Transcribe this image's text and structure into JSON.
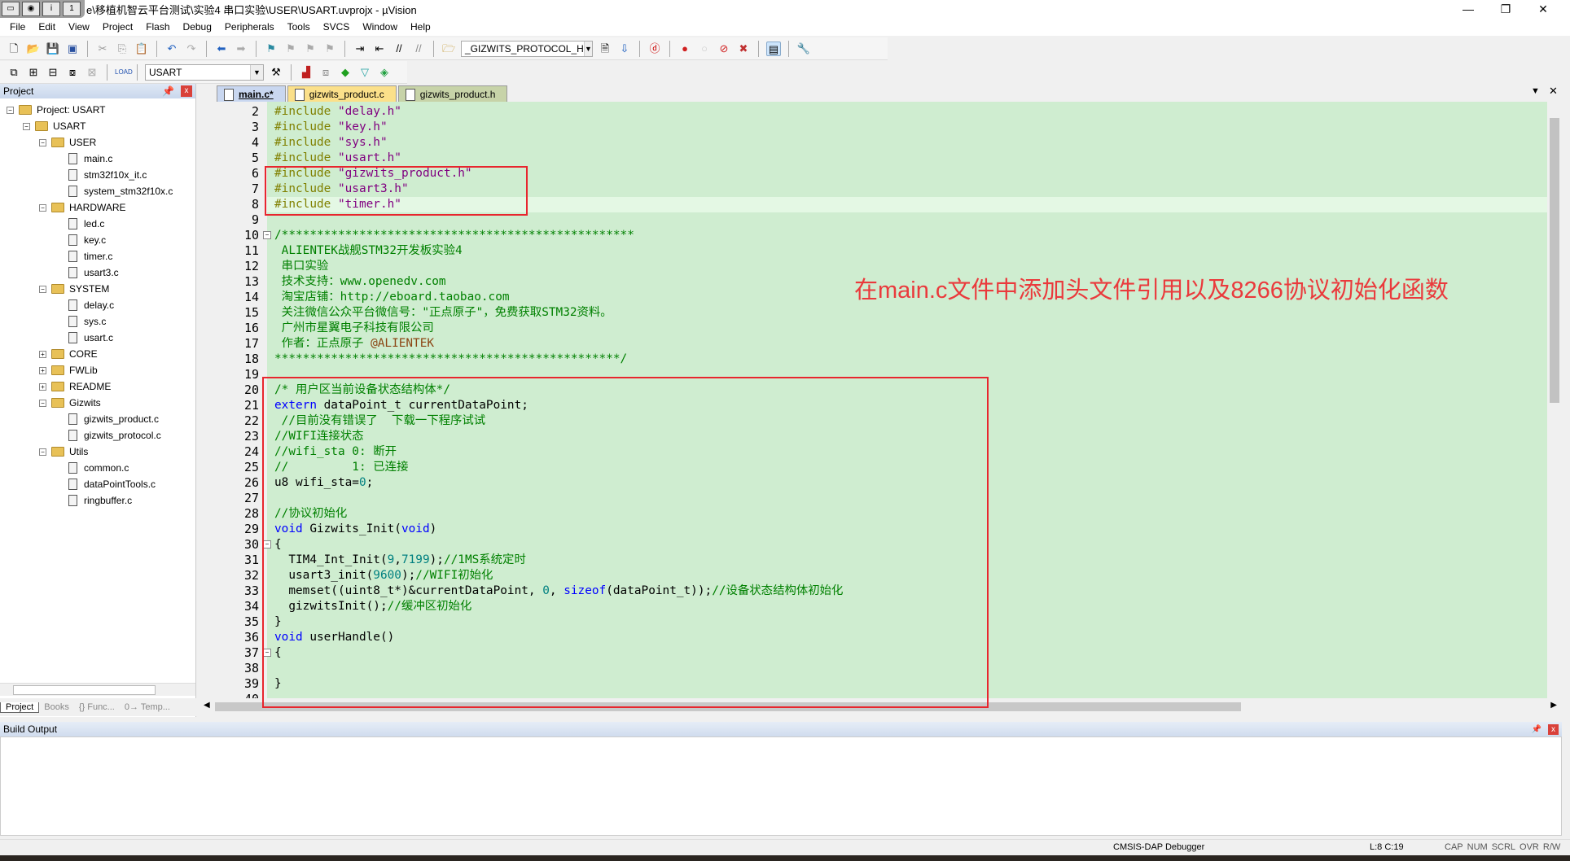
{
  "window": {
    "title": "e\\移植机智云平台测试\\实验4 串口实验\\USER\\USART.uvprojx - µVision",
    "minimize": "—",
    "restore": "❐",
    "close": "✕"
  },
  "menu": [
    "File",
    "Edit",
    "View",
    "Project",
    "Flash",
    "Debug",
    "Peripherals",
    "Tools",
    "SVCS",
    "Window",
    "Help"
  ],
  "toolbar": {
    "find_combo": "_GIZWITS_PROTOCOL_H",
    "target_combo": "USART"
  },
  "project_panel": {
    "title": "Project",
    "tree": [
      {
        "label": "Project: USART",
        "level": 0,
        "type": "root",
        "toggle": "−"
      },
      {
        "label": "USART",
        "level": 1,
        "type": "folder",
        "toggle": "−"
      },
      {
        "label": "USER",
        "level": 2,
        "type": "folder",
        "toggle": "−"
      },
      {
        "label": "main.c",
        "level": 3,
        "type": "file"
      },
      {
        "label": "stm32f10x_it.c",
        "level": 3,
        "type": "file"
      },
      {
        "label": "system_stm32f10x.c",
        "level": 3,
        "type": "file"
      },
      {
        "label": "HARDWARE",
        "level": 2,
        "type": "folder",
        "toggle": "−"
      },
      {
        "label": "led.c",
        "level": 3,
        "type": "file"
      },
      {
        "label": "key.c",
        "level": 3,
        "type": "file"
      },
      {
        "label": "timer.c",
        "level": 3,
        "type": "file"
      },
      {
        "label": "usart3.c",
        "level": 3,
        "type": "file"
      },
      {
        "label": "SYSTEM",
        "level": 2,
        "type": "folder",
        "toggle": "−"
      },
      {
        "label": "delay.c",
        "level": 3,
        "type": "file"
      },
      {
        "label": "sys.c",
        "level": 3,
        "type": "file"
      },
      {
        "label": "usart.c",
        "level": 3,
        "type": "file"
      },
      {
        "label": "CORE",
        "level": 2,
        "type": "folder",
        "toggle": "+"
      },
      {
        "label": "FWLib",
        "level": 2,
        "type": "folder",
        "toggle": "+"
      },
      {
        "label": "README",
        "level": 2,
        "type": "folder",
        "toggle": "+"
      },
      {
        "label": "Gizwits",
        "level": 2,
        "type": "folder",
        "toggle": "−"
      },
      {
        "label": "gizwits_product.c",
        "level": 3,
        "type": "file"
      },
      {
        "label": "gizwits_protocol.c",
        "level": 3,
        "type": "file"
      },
      {
        "label": "Utils",
        "level": 2,
        "type": "folder",
        "toggle": "−"
      },
      {
        "label": "common.c",
        "level": 3,
        "type": "file"
      },
      {
        "label": "dataPointTools.c",
        "level": 3,
        "type": "file"
      },
      {
        "label": "ringbuffer.c",
        "level": 3,
        "type": "file"
      }
    ],
    "bottom_tabs": [
      "Project",
      "Books",
      "{} Func...",
      "0→ Temp..."
    ]
  },
  "editor_tabs": [
    {
      "label": "main.c*",
      "active": true,
      "color": "#c9d7f0"
    },
    {
      "label": "gizwits_product.c",
      "active": false,
      "color": "#fbe08a"
    },
    {
      "label": "gizwits_product.h",
      "active": false,
      "color": "#c7d3a8"
    }
  ],
  "code": {
    "current_line": 8,
    "lines": [
      {
        "n": 2,
        "s": [
          [
            "#include ",
            "pp"
          ],
          [
            "\"delay.h\"",
            "str"
          ]
        ]
      },
      {
        "n": 3,
        "s": [
          [
            "#include ",
            "pp"
          ],
          [
            "\"key.h\"",
            "str"
          ]
        ]
      },
      {
        "n": 4,
        "s": [
          [
            "#include ",
            "pp"
          ],
          [
            "\"sys.h\"",
            "str"
          ]
        ]
      },
      {
        "n": 5,
        "s": [
          [
            "#include ",
            "pp"
          ],
          [
            "\"usart.h\"",
            "str"
          ]
        ]
      },
      {
        "n": 6,
        "s": [
          [
            "#include ",
            "pp"
          ],
          [
            "\"gizwits_product.h\"",
            "str"
          ]
        ]
      },
      {
        "n": 7,
        "s": [
          [
            "#include ",
            "pp"
          ],
          [
            "\"usart3.h\"",
            "str"
          ]
        ]
      },
      {
        "n": 8,
        "s": [
          [
            "#include ",
            "pp"
          ],
          [
            "\"timer.h\"",
            "str"
          ]
        ]
      },
      {
        "n": 9,
        "s": []
      },
      {
        "n": 10,
        "fold": true,
        "s": [
          [
            "/**************************************************",
            "cm"
          ]
        ]
      },
      {
        "n": 11,
        "s": [
          [
            " ALIENTEK战舰STM32开发板实验4",
            "cm"
          ]
        ]
      },
      {
        "n": 12,
        "s": [
          [
            " 串口实验",
            "cm"
          ]
        ]
      },
      {
        "n": 13,
        "s": [
          [
            " 技术支持：www.openedv.com",
            "cm"
          ]
        ]
      },
      {
        "n": 14,
        "s": [
          [
            " 淘宝店铺：http://eboard.taobao.com",
            "cm"
          ]
        ]
      },
      {
        "n": 15,
        "s": [
          [
            " 关注微信公众平台微信号：\"正点原子\"，免费获取STM32资料。",
            "cm"
          ]
        ]
      },
      {
        "n": 16,
        "s": [
          [
            " 广州市星翼电子科技有限公司",
            "cm"
          ]
        ]
      },
      {
        "n": 17,
        "s": [
          [
            " 作者：正点原子 ",
            "cm"
          ],
          [
            "@ALIENTEK",
            "cmb"
          ]
        ]
      },
      {
        "n": 18,
        "s": [
          [
            "*************************************************/",
            "cm"
          ]
        ]
      },
      {
        "n": 19,
        "s": []
      },
      {
        "n": 20,
        "s": [
          [
            "/* 用户区当前设备状态结构体*/",
            "cm"
          ]
        ]
      },
      {
        "n": 21,
        "s": [
          [
            "extern",
            "kw"
          ],
          [
            " dataPoint_t currentDataPoint;",
            "tx"
          ]
        ]
      },
      {
        "n": 22,
        "s": [
          [
            " //目前没有错误了  下载一下程序试试",
            "cm"
          ]
        ]
      },
      {
        "n": 23,
        "s": [
          [
            "//WIFI连接状态",
            "cm"
          ]
        ]
      },
      {
        "n": 24,
        "s": [
          [
            "//wifi_sta 0: 断开",
            "cm"
          ]
        ]
      },
      {
        "n": 25,
        "s": [
          [
            "//         1: 已连接",
            "cm"
          ]
        ]
      },
      {
        "n": 26,
        "s": [
          [
            "u8 wifi_sta=",
            "tx"
          ],
          [
            "0",
            "num"
          ],
          [
            ";",
            "tx"
          ]
        ]
      },
      {
        "n": 27,
        "s": []
      },
      {
        "n": 28,
        "s": [
          [
            "//协议初始化",
            "cm"
          ]
        ]
      },
      {
        "n": 29,
        "s": [
          [
            "void",
            "kw"
          ],
          [
            " Gizwits_Init(",
            "tx"
          ],
          [
            "void",
            "kw"
          ],
          [
            ")",
            "tx"
          ]
        ]
      },
      {
        "n": 30,
        "fold": true,
        "s": [
          [
            "{",
            "tx"
          ]
        ]
      },
      {
        "n": 31,
        "s": [
          [
            "  TIM4_Int_Init(",
            "tx"
          ],
          [
            "9",
            "num"
          ],
          [
            ",",
            "tx"
          ],
          [
            "7199",
            "num"
          ],
          [
            ");",
            "tx"
          ],
          [
            "//1MS系统定时",
            "cm"
          ]
        ]
      },
      {
        "n": 32,
        "s": [
          [
            "  usart3_init(",
            "tx"
          ],
          [
            "9600",
            "num"
          ],
          [
            ");",
            "tx"
          ],
          [
            "//WIFI初始化",
            "cm"
          ]
        ]
      },
      {
        "n": 33,
        "s": [
          [
            "  memset((uint8_t*)&currentDataPoint, ",
            "tx"
          ],
          [
            "0",
            "num"
          ],
          [
            ", ",
            "tx"
          ],
          [
            "sizeof",
            "kw"
          ],
          [
            "(dataPoint_t));",
            "tx"
          ],
          [
            "//设备状态结构体初始化",
            "cm"
          ]
        ]
      },
      {
        "n": 34,
        "s": [
          [
            "  gizwitsInit();",
            "tx"
          ],
          [
            "//缓冲区初始化",
            "cm"
          ]
        ]
      },
      {
        "n": 35,
        "s": [
          [
            "}",
            "tx"
          ]
        ]
      },
      {
        "n": 36,
        "s": [
          [
            "void",
            "kw"
          ],
          [
            " userHandle()",
            "tx"
          ]
        ]
      },
      {
        "n": 37,
        "fold": true,
        "s": [
          [
            "{",
            "tx"
          ]
        ]
      },
      {
        "n": 38,
        "s": []
      },
      {
        "n": 39,
        "s": [
          [
            "}",
            "tx"
          ]
        ]
      },
      {
        "n": 40,
        "s": []
      }
    ]
  },
  "annotation": "在main.c文件中添加头文件引用以及8266协议初始化函数",
  "build_output": {
    "title": "Build Output"
  },
  "status": {
    "debugger": "CMSIS-DAP Debugger",
    "cursor": "L:8 C:19",
    "indicators": [
      "CAP",
      "NUM",
      "SCRL",
      "OVR",
      "R/W"
    ]
  },
  "colors": {
    "editor_bg": "#cfedd0",
    "annotation": "#ea3a3c",
    "highlight_box": "#e8262e"
  }
}
